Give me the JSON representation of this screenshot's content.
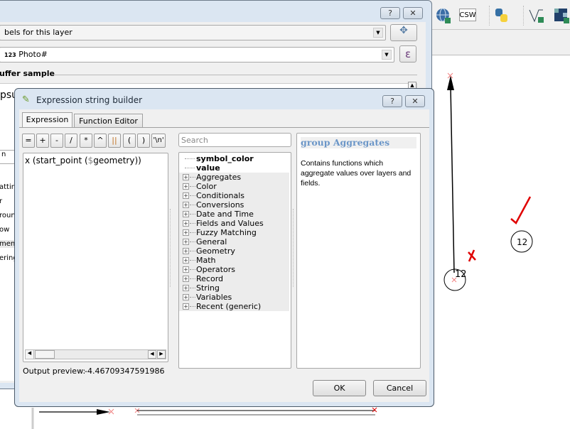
{
  "toolbar": {
    "icons": [
      "globe-search-icon",
      "csw-icon",
      "python-icon",
      "add-vector-vertex-icon",
      "add-raster-icon"
    ],
    "csw_label": "CSW"
  },
  "back_dialog": {
    "label_mode": "bels for this layer",
    "label_field_type": "123",
    "label_field": "Photo#",
    "section_title": "uffer sample",
    "text_fragment": "psu",
    "left_list": [
      "atting",
      "r",
      "roun",
      "ow",
      "ment",
      "ering"
    ],
    "small_field": "n",
    "epsilon_label": "ε"
  },
  "expression_dialog": {
    "title": "Expression string builder",
    "help_label": "?",
    "close_label": "✕",
    "tabs": [
      {
        "label": "Expression",
        "active": true
      },
      {
        "label": "Function Editor",
        "active": false
      }
    ],
    "operators": [
      "=",
      "+",
      "-",
      "/",
      "*",
      "^",
      "||",
      "(",
      ")",
      "'\\n'"
    ],
    "expression_text_pre": "x (start_point (",
    "expression_var": "$",
    "expression_text_post": "geometry))",
    "search_placeholder": "Search",
    "tree": {
      "fields": [
        "symbol_color",
        "value"
      ],
      "groups": [
        "Aggregates",
        "Color",
        "Conditionals",
        "Conversions",
        "Date and Time",
        "Fields and Values",
        "Fuzzy Matching",
        "General",
        "Geometry",
        "Math",
        "Operators",
        "Record",
        "String",
        "Variables",
        "Recent (generic)"
      ]
    },
    "help": {
      "title": "group Aggregates",
      "description": "Contains functions which aggregate values over layers and fields."
    },
    "output_preview_label": "Output preview:",
    "output_preview_value": "-4.46709347591986",
    "ok_label": "OK",
    "cancel_label": "Cancel"
  },
  "map": {
    "labels": [
      "12",
      "12"
    ],
    "accent_color": "#e00000"
  }
}
